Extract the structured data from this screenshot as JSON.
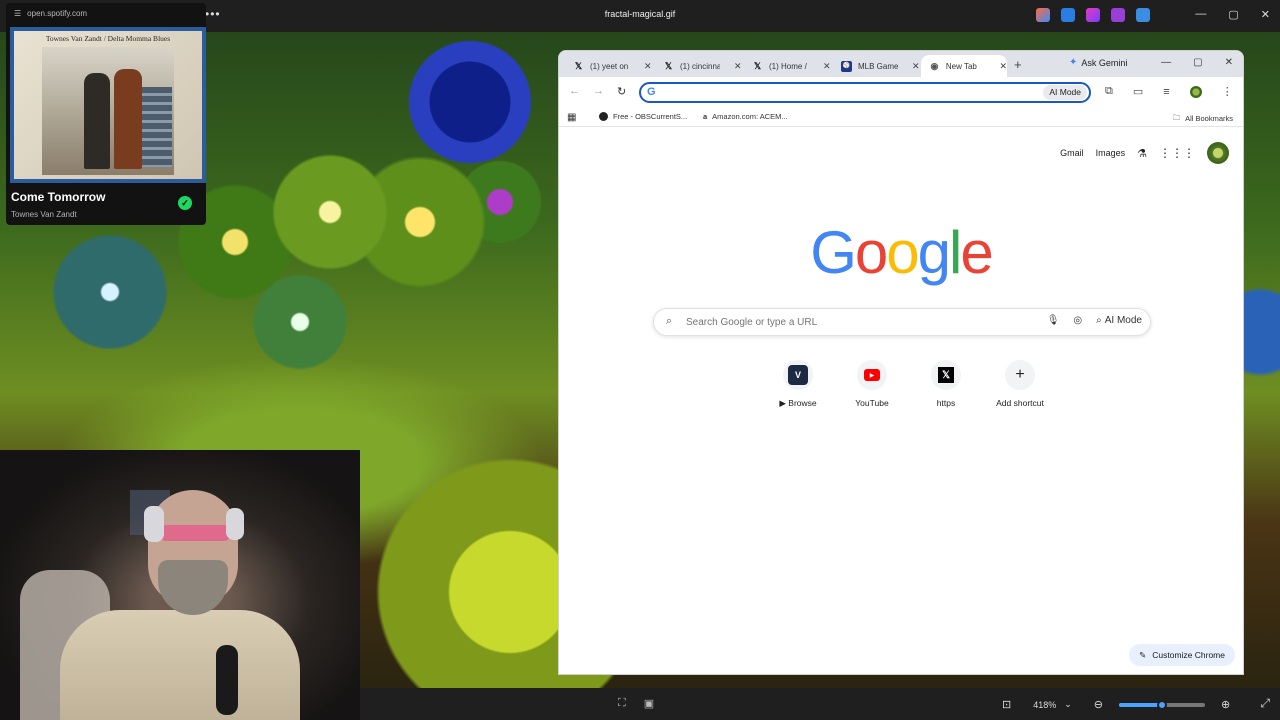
{
  "viewer": {
    "title": "fractal-magical.gif",
    "menu_dots": "•••",
    "zoom": "418%",
    "zoom_level": 0.5
  },
  "spotify": {
    "url": "open.spotify.com",
    "album_text": "Townes Van Zandt / Delta Momma Blues",
    "track_title": "Come Tomorrow",
    "artist": "Townes Van Zandt"
  },
  "chrome": {
    "tabs": [
      {
        "label": "(1) yeet on",
        "icon": "x-icon"
      },
      {
        "label": "(1) cincinna",
        "icon": "x-icon"
      },
      {
        "label": "(1) Home /",
        "icon": "x-icon"
      },
      {
        "label": "MLB Game",
        "icon": "mlb-icon"
      },
      {
        "label": "New Tab",
        "icon": "chrome-icon"
      }
    ],
    "ask_gemini": "Ask Gemini",
    "omnibox_value": "",
    "omnibox_ai_mode": "AI Mode",
    "bookmarks": [
      {
        "label": "Free - OBSCurrentS..."
      },
      {
        "label": "Amazon.com: ACEM..."
      }
    ],
    "all_bookmarks": "All Bookmarks"
  },
  "ntp": {
    "gmail": "Gmail",
    "images": "Images",
    "logo": [
      "G",
      "o",
      "o",
      "g",
      "l",
      "e"
    ],
    "logo_colors": [
      "#4285F4",
      "#EA4335",
      "#FBBC05",
      "#4285F4",
      "#34A853",
      "#EA4335"
    ],
    "search_placeholder": "Search Google or type a URL",
    "ai_mode": "AI Mode",
    "shortcuts": [
      {
        "label": "▶ Browse",
        "icon": "browse-icon"
      },
      {
        "label": "YouTube",
        "icon": "youtube-icon"
      },
      {
        "label": "https",
        "icon": "x-icon"
      },
      {
        "label": "Add shortcut",
        "icon": "plus-icon"
      }
    ],
    "customize": "Customize Chrome"
  }
}
